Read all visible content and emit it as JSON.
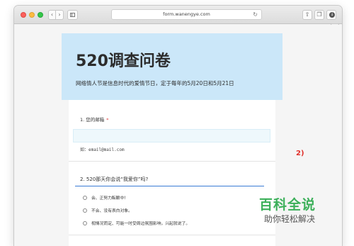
{
  "browser": {
    "url": "form.wanengye.com",
    "back_icon": "chevron-left",
    "forward_icon": "chevron-right",
    "reload_icon": "reload",
    "share_icon": "share",
    "tabs_icon": "tabs",
    "download_icon": "download",
    "plus_label": "+"
  },
  "survey": {
    "title": "520调查问卷",
    "subtitle": "网络情人节是信息时代的爱情节日，定于每年的5月20日和5月21日",
    "header_color": "#cbe7f9"
  },
  "questions": {
    "q1": {
      "label": "1. 您的邮箱",
      "required_mark": "*",
      "hint": "如：email@mail.com"
    },
    "q2": {
      "label": "2. 520那天你会说“我爱你”吗?",
      "options": [
        "会、正努力酝酿中!",
        "不会、没有表白对象。",
        "视情况而定、可能一时受周边氛围影响，兴起就说了。"
      ]
    }
  },
  "annotation": "2)",
  "watermark": {
    "title": "百科全说",
    "subtitle": "助你轻松解决"
  },
  "colors": {
    "accent": "#3a7bd5",
    "required": "#e03a3a",
    "annotation": "#e0302a",
    "watermark_green": "#3cb05a"
  }
}
